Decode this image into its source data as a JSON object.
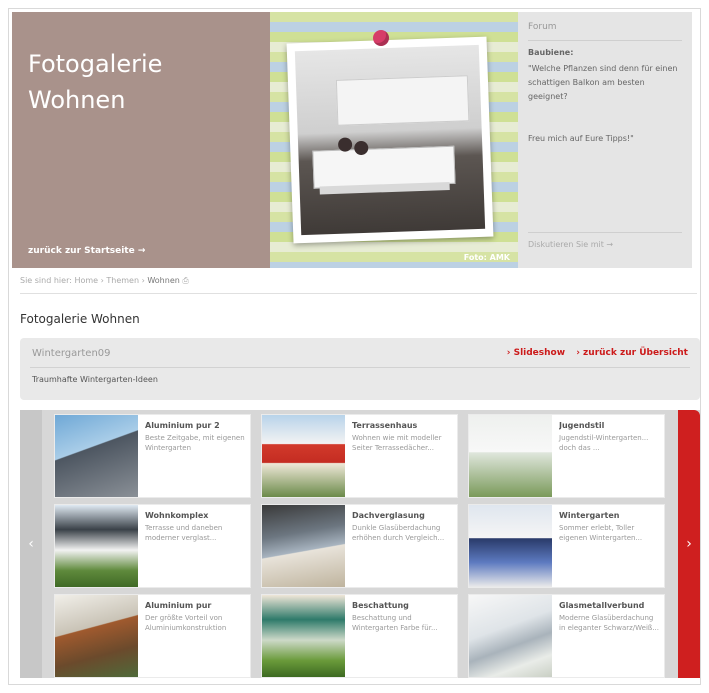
{
  "hero": {
    "title": "Fotogalerie\nWohnen",
    "back_link": "zurück zur Startseite →",
    "photo_credit": "Foto: AMK"
  },
  "forum": {
    "title": "Forum",
    "author": "Baubiene:",
    "quote": "\"Welche Pflanzen sind denn für einen schattigen Balkon am besten geeignet?",
    "tail": "Freu mich auf Eure Tipps!\"",
    "cta": "Diskutieren Sie mit →"
  },
  "breadcrumb": {
    "prefix": "Sie sind hier:",
    "items": [
      "Home",
      "Themen",
      "Wohnen"
    ],
    "separator": "›",
    "print_icon": "printer-icon"
  },
  "page": {
    "heading": "Fotogalerie Wohnen"
  },
  "album": {
    "title": "Wintergarten09",
    "slideshow": "› Slideshow",
    "overview": "› zurück zur Übersicht",
    "subtitle": "Traumhafte Wintergarten-Ideen"
  },
  "gallery": {
    "prev": "‹",
    "next": "›",
    "items": [
      {
        "title": "Aluminium pur 2",
        "text": "Beste Zeitgabe, mit eigenen Wintergarten"
      },
      {
        "title": "Terrassenhaus",
        "text": "Wohnen wie mit modeller Seiter Terrassedächer..."
      },
      {
        "title": "Jugendstil",
        "text": "Jugendstil-Wintergarten... doch das ..."
      },
      {
        "title": "Wohnkomplex",
        "text": "Terrasse und daneben moderner verglast..."
      },
      {
        "title": "Dachverglasung",
        "text": "Dunkle Glasüberdachung erhöhen durch Vergleich..."
      },
      {
        "title": "Wintergarten",
        "text": "Sommer erlebt, Toller eigenen Wintergarten..."
      },
      {
        "title": "Aluminium pur",
        "text": "Der größte Vorteil von Aluminiumkonstruktion"
      },
      {
        "title": "Beschattung",
        "text": "Beschattung und Wintergarten Farbe für..."
      },
      {
        "title": "Glasmetallverbund",
        "text": "Moderne Glasüberdachung in eleganter Schwarz/Weiß..."
      }
    ]
  }
}
